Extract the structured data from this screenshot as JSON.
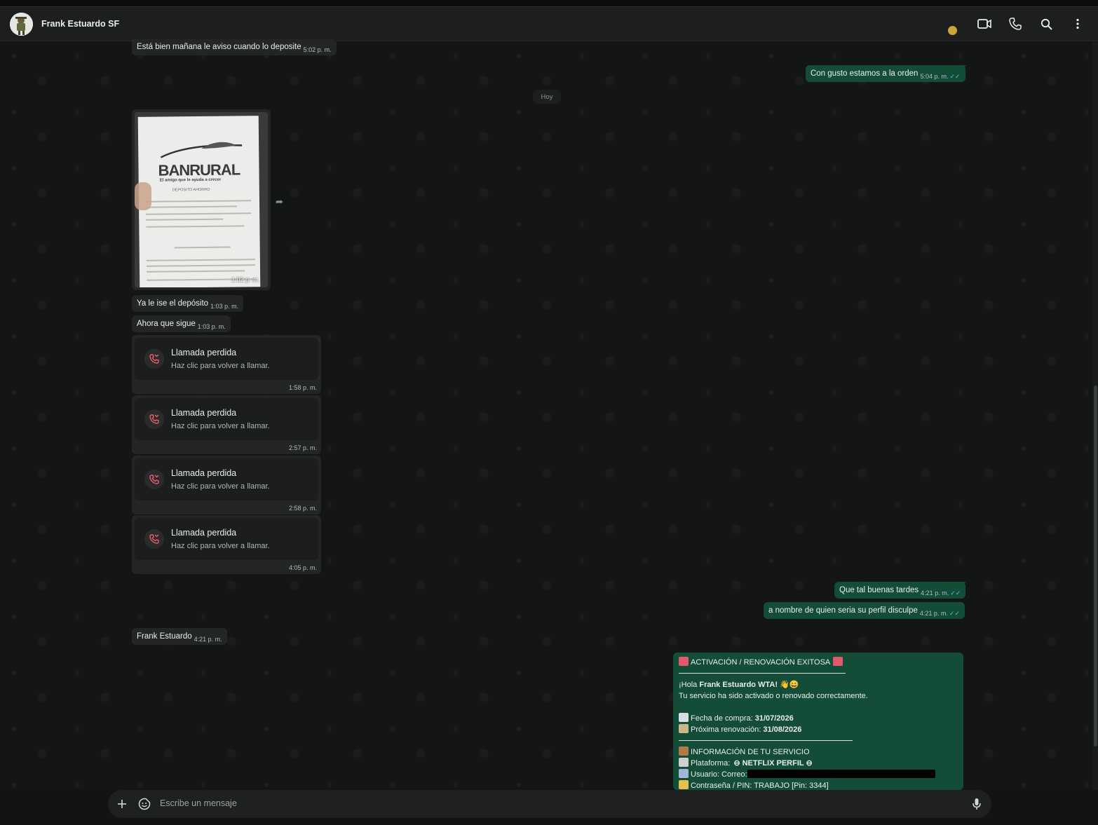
{
  "header": {
    "contact_name": "Frank Estuardo SF",
    "status_dot_color": "#c9a43a",
    "icons": [
      "video-call-icon",
      "phone-call-icon",
      "search-icon",
      "menu-dots-icon"
    ]
  },
  "messages": {
    "m1": {
      "text": "Está bien mañana le aviso cuando lo deposite",
      "time": "5:02 p. m."
    },
    "m2": {
      "text": "Con gusto estamos a la orden",
      "time": "5:04 p. m.",
      "ticks": "✓✓"
    },
    "day_separator": "Hoy",
    "image": {
      "bank": "BANRURAL",
      "slogan": "El amigo que le ayuda a crecer",
      "doc_title": "DEPOSITO AHORRO",
      "time": "1:02 p. m."
    },
    "m3": {
      "text": "Ya le ise el depósito",
      "time": "1:03 p. m."
    },
    "m4": {
      "text": "Ahora que sigue",
      "time": "1:03 p. m."
    },
    "calls": [
      {
        "title": "Llamada perdida",
        "subtitle": "Haz clic para volver a llamar.",
        "time": "1:58 p. m."
      },
      {
        "title": "Llamada perdida",
        "subtitle": "Haz clic para volver a llamar.",
        "time": "2:57 p. m."
      },
      {
        "title": "Llamada perdida",
        "subtitle": "Haz clic para volver a llamar.",
        "time": "2:58 p. m."
      },
      {
        "title": "Llamada perdida",
        "subtitle": "Haz clic para volver a llamar.",
        "time": "4:05 p. m."
      }
    ],
    "m5": {
      "text": "Que tal buenas tardes",
      "time": "4:21 p. m.",
      "ticks": "✓✓"
    },
    "m6": {
      "text": "a nombre de quien seria su perfil disculpe",
      "time": "4:21 p. m.",
      "ticks": "✓✓"
    },
    "m7": {
      "text": "Frank Estuardo",
      "time": "4:21 p. m."
    },
    "card": {
      "heading": "ACTIVACIÓN / RENOVACIÓN EXITOSA",
      "greeting_prefix": "¡Hola ",
      "greeting_name": "Frank Estuardo WTA!",
      "greeting_emoji": "👋😄",
      "line_activated": "Tu servicio ha sido activado o renovado correctamente.",
      "purchase_label": "Fecha de compra: ",
      "purchase_date": "31/07/2026",
      "renewal_label": "Próxima renovación: ",
      "renewal_date": "31/08/2026",
      "info_heading": "INFORMACIÓN DE TU SERVICIO",
      "platform_label": "Plataforma: ",
      "platform_value": "NETFLIX PERFIL",
      "user_label": "Usuario: Correo:",
      "password_line": "Contraseña / PIN: TRABAJO [Pin: 3344]"
    }
  },
  "composer": {
    "placeholder": "Escribe un mensaje"
  },
  "colors": {
    "incoming_bubble": "#242626",
    "outgoing_bubble": "#144d37",
    "read_ticks": "#53bdeb",
    "missed_call": "#f15c6d"
  }
}
